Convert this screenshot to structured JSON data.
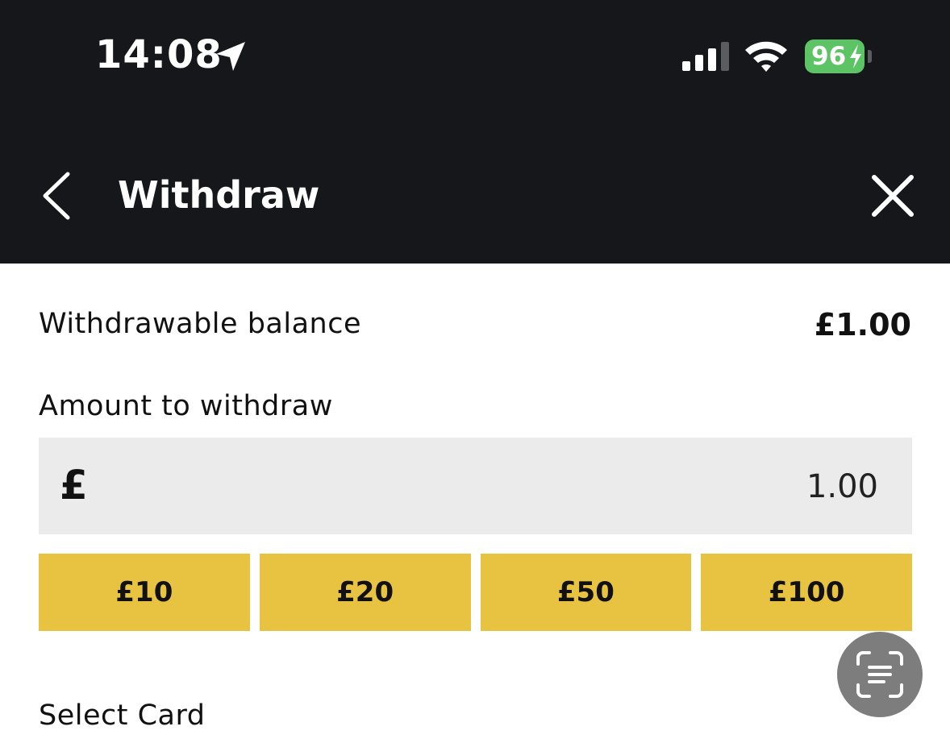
{
  "status_bar": {
    "time": "14:08",
    "battery": "96",
    "battery_color": "#5dc466",
    "icons": [
      "location-arrow-icon",
      "signal-icon",
      "wifi-icon",
      "battery-icon"
    ]
  },
  "header": {
    "title": "Withdraw",
    "back_icon": "chevron-left-icon",
    "close_icon": "close-icon",
    "background": "#16171b"
  },
  "balance": {
    "label": "Withdrawable balance",
    "value": "£1.00"
  },
  "amount": {
    "label": "Amount to withdraw",
    "currency_symbol": "£",
    "value": "1.00"
  },
  "quick_amounts": [
    "£10",
    "£20",
    "£50",
    "£100"
  ],
  "quick_amount_color": "#e8c342",
  "select_card": {
    "label": "Select Card"
  },
  "fab": {
    "icon": "text-scan-icon"
  }
}
